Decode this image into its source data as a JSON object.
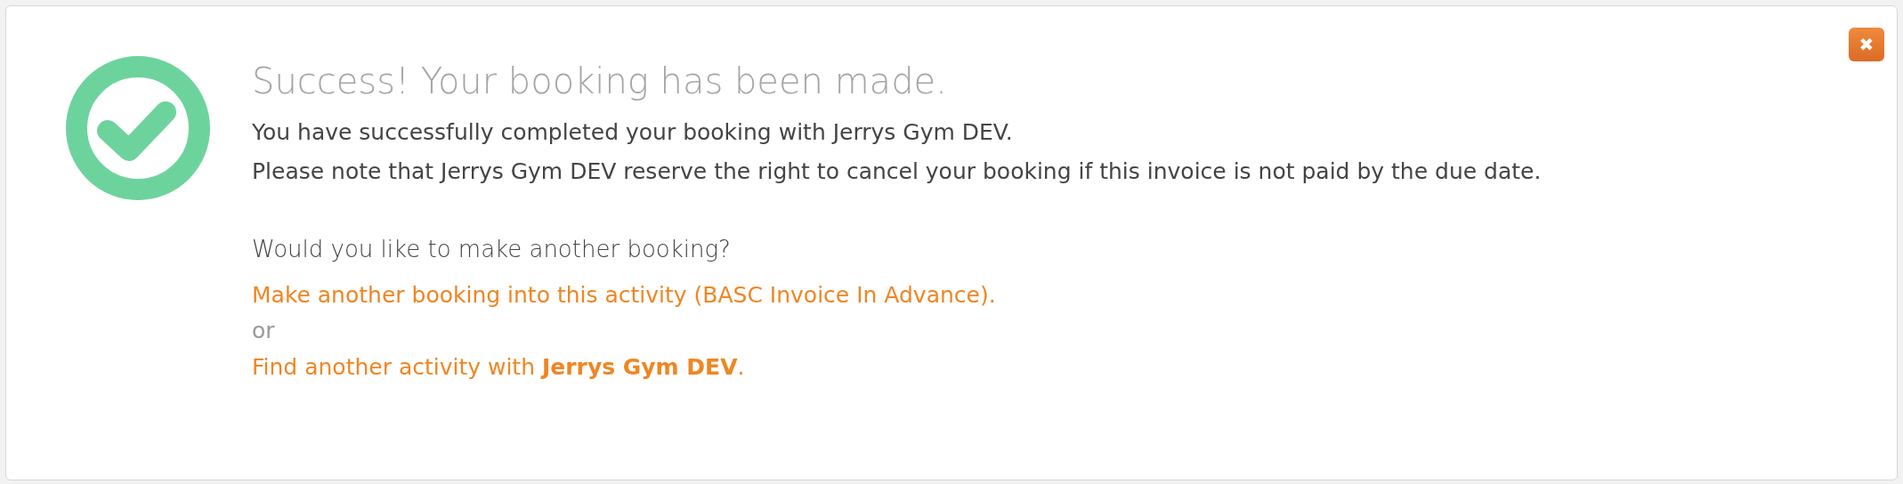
{
  "close_button": {
    "label": "✖"
  },
  "title": "Success! Your booking has been made.",
  "message_lines": [
    "You have successfully completed your booking with Jerrys Gym DEV.",
    "Please note that Jerrys Gym DEV reserve the right to cancel your booking if this invoice is not paid by the due date."
  ],
  "question": "Would you like to make another booking?",
  "options": [
    {
      "kind": "link",
      "text": "Make another booking into this activity (BASC Invoice In Advance)."
    },
    {
      "kind": "separator",
      "text": "or"
    },
    {
      "kind": "link",
      "text": "Find another activity with **Jerrys Gym DEV**."
    }
  ]
}
